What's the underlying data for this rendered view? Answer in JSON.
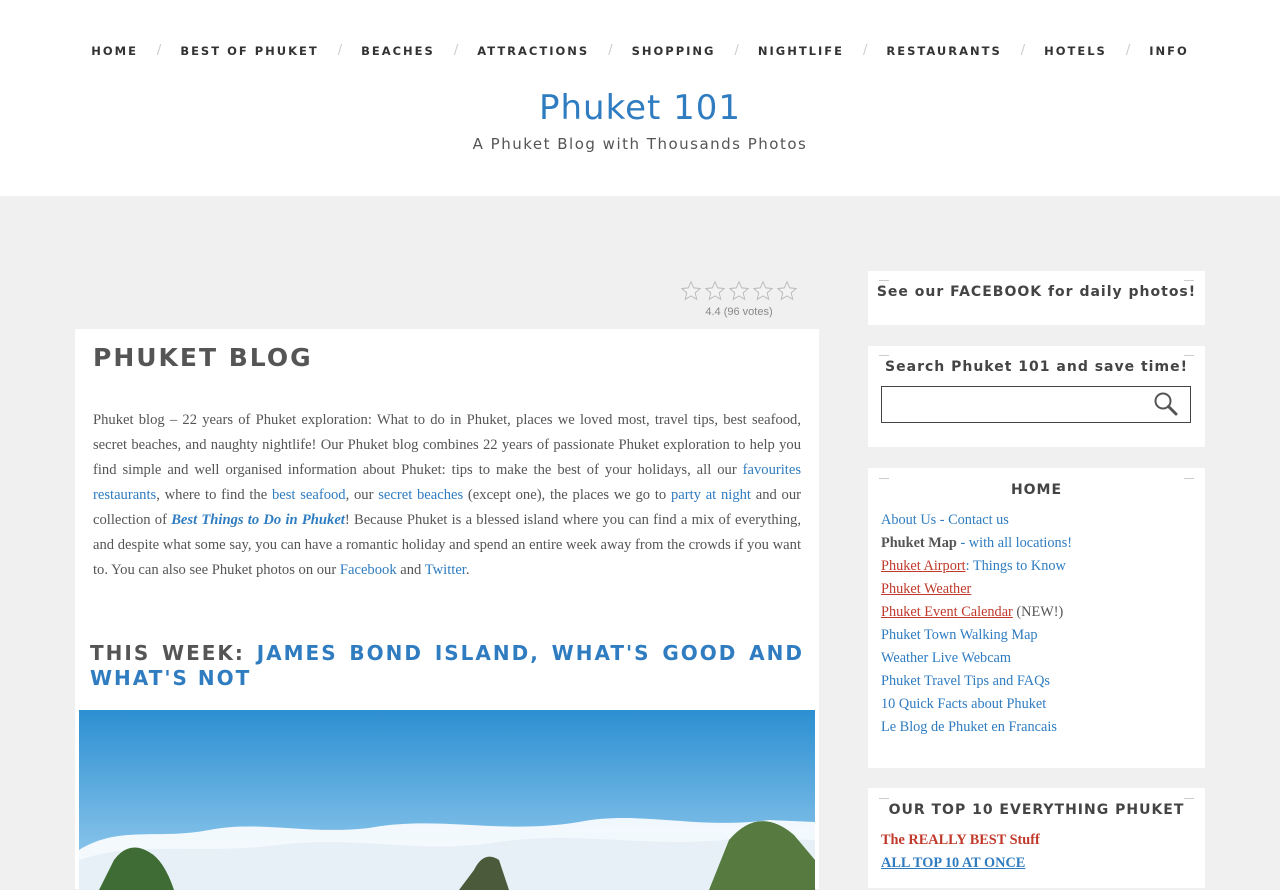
{
  "nav": {
    "items": [
      "HOME",
      "BEST OF PHUKET",
      "BEACHES",
      "ATTRACTIONS",
      "SHOPPING",
      "NIGHTLIFE",
      "RESTAURANTS",
      "HOTELS",
      "INFO"
    ],
    "separator": "/"
  },
  "site": {
    "title": "Phuket 101",
    "tagline": "A Phuket Blog with Thousands Photos"
  },
  "rating": {
    "value": 4.4,
    "max": 5,
    "votes": 96,
    "text": "4.4 (96 votes)"
  },
  "main": {
    "title": "PHUKET BLOG",
    "intro": {
      "t1": "Phuket blog – 22 years of Phuket exploration: What to do in Phuket, places we loved most, travel tips, best seafood, secret beaches, and naughty nightlife! Our Phuket blog combines 22 years of passionate Phuket exploration to help you find simple and well organised information about Phuket: tips to make the best of your holidays, all our ",
      "l1": "favourites restaurants",
      "t2": ", where to find the ",
      "l2": "best seafood",
      "t3": ", our ",
      "l3": "secret beaches",
      "t4": " (except one), the places we go to ",
      "l4": "party at night",
      "t5": " and our collection of ",
      "l5": "Best Things to Do in Phuket",
      "t6": "! Because Phuket is a blessed island where you can find a mix of everything, and despite what some say, you can have a romantic holiday and spend an entire week away from the crowds if you want to. You can also see Phuket photos on our ",
      "l6": "Facebook",
      "t7": " and ",
      "l7": "Twitter",
      "t8": "."
    },
    "this_week_label": "THIS WEEK: ",
    "this_week_link": "JAMES BOND ISLAND, WHAT'S GOOD AND WHAT'S NOT"
  },
  "sidebar": {
    "facebook_title": "See our FACEBOOK for daily photos!",
    "search_title": "Search Phuket 101 and save time!",
    "search_value": "",
    "home_title": "HOME",
    "home_links": {
      "about": "About Us - Contact us",
      "map_bold": "Phuket Map",
      "map_rest": " - with all locations!",
      "airport": "Phuket Airport",
      "airport_rest": ": Things to Know",
      "weather": "Phuket Weather",
      "events": "Phuket Event Calendar",
      "events_new": " (NEW!)",
      "walking": "Phuket Town Walking Map",
      "webcam": "Weather Live Webcam",
      "tips": "Phuket Travel Tips and FAQs",
      "facts": "10 Quick Facts about Phuket",
      "french": "Le Blog de Phuket en Francais"
    },
    "top10_title": "OUR TOP 10 EVERYTHING PHUKET",
    "top10_links": {
      "best": "The REALLY BEST Stuff",
      "all": "ALL TOP 10 AT ONCE "
    }
  },
  "colors": {
    "link": "#2f7cc0",
    "accent_red": "#c0392b",
    "background": "#f0f0f0"
  }
}
